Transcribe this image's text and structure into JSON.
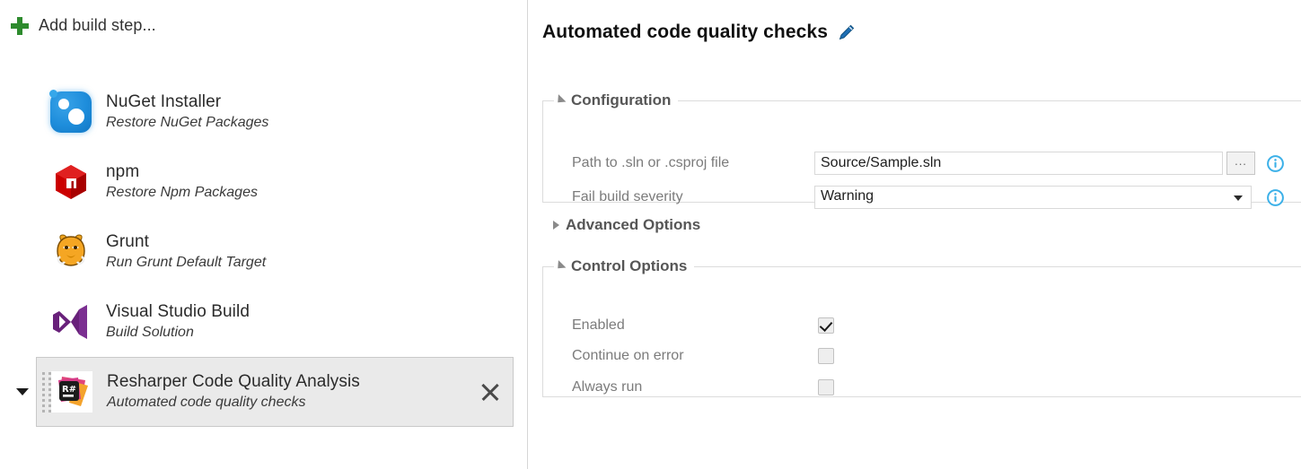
{
  "left_panel": {
    "add_build_step": {
      "label": "Add build step...",
      "icon": "plus-icon"
    },
    "expand_chevron_icon": "chevron-down-icon",
    "steps": [
      {
        "title": "NuGet Installer",
        "subtitle": "Restore NuGet Packages",
        "icon": "nuget-icon",
        "selected": false
      },
      {
        "title": "npm",
        "subtitle": "Restore Npm Packages",
        "icon": "npm-icon",
        "selected": false
      },
      {
        "title": "Grunt",
        "subtitle": "Run Grunt Default Target",
        "icon": "grunt-icon",
        "selected": false
      },
      {
        "title": "Visual Studio Build",
        "subtitle": "Build Solution",
        "icon": "visual-studio-icon",
        "selected": false
      },
      {
        "title": "Resharper Code Quality Analysis",
        "subtitle": "Automated code quality checks",
        "icon": "resharper-icon",
        "selected": true,
        "remove_icon": "close-icon",
        "drag_icon": "drag-handle-icon"
      }
    ]
  },
  "right_panel": {
    "title": "Automated code quality checks",
    "edit_icon": "pencil-icon",
    "sections": {
      "configuration": {
        "legend": "Configuration",
        "expanded": true,
        "toggle_icon": "triangle-down-icon",
        "fields": [
          {
            "label": "Path to .sln or .csproj file",
            "type": "text",
            "value": "Source/Sample.sln",
            "placeholder": "",
            "browse_label": "...",
            "browse_icon": "ellipsis-icon",
            "info_icon": "info-icon"
          },
          {
            "label": "Fail build severity",
            "type": "select",
            "value": "Warning",
            "arrow_icon": "chevron-down-icon",
            "info_icon": "info-icon"
          }
        ]
      },
      "advanced_options": {
        "legend": "Advanced Options",
        "expanded": false,
        "toggle_icon": "triangle-right-icon"
      },
      "control_options": {
        "legend": "Control Options",
        "expanded": true,
        "toggle_icon": "triangle-down-icon",
        "checkboxes": [
          {
            "label": "Enabled",
            "checked": true
          },
          {
            "label": "Continue on error",
            "checked": false
          },
          {
            "label": "Always run",
            "checked": false
          }
        ]
      }
    }
  },
  "colors": {
    "accent_blue": "#1f6fb5",
    "info_blue": "#3bb0e8",
    "plus_green": "#2e8b2e",
    "selected_row_bg": "#eaeaea",
    "divider": "#d6d6d6"
  }
}
